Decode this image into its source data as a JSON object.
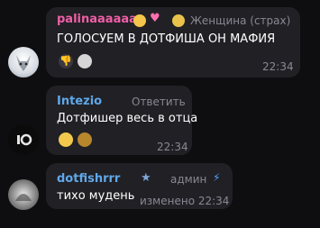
{
  "messages": [
    {
      "sender": "palinaaaaaa",
      "sender_color": "#ef5fa6",
      "badge": "Женщина (страх)",
      "text": "ГОЛОСУЕМ В ДОТФИША ОН МАФИЯ",
      "time": "22:34",
      "reactions": [
        "thumbs-down",
        "skull-art"
      ]
    },
    {
      "sender": "Intezio",
      "sender_color": "#5fa8ea",
      "action": "Ответить",
      "text": "Дотфишер весь в отца",
      "time": "22:34",
      "reactions": [
        "grinning",
        "cowboy"
      ]
    },
    {
      "sender": "dotfishrrr",
      "sender_color": "#5fa8ea",
      "role": "админ",
      "text": "тихо мудень",
      "edited_time": "изменено 22:34"
    }
  ]
}
